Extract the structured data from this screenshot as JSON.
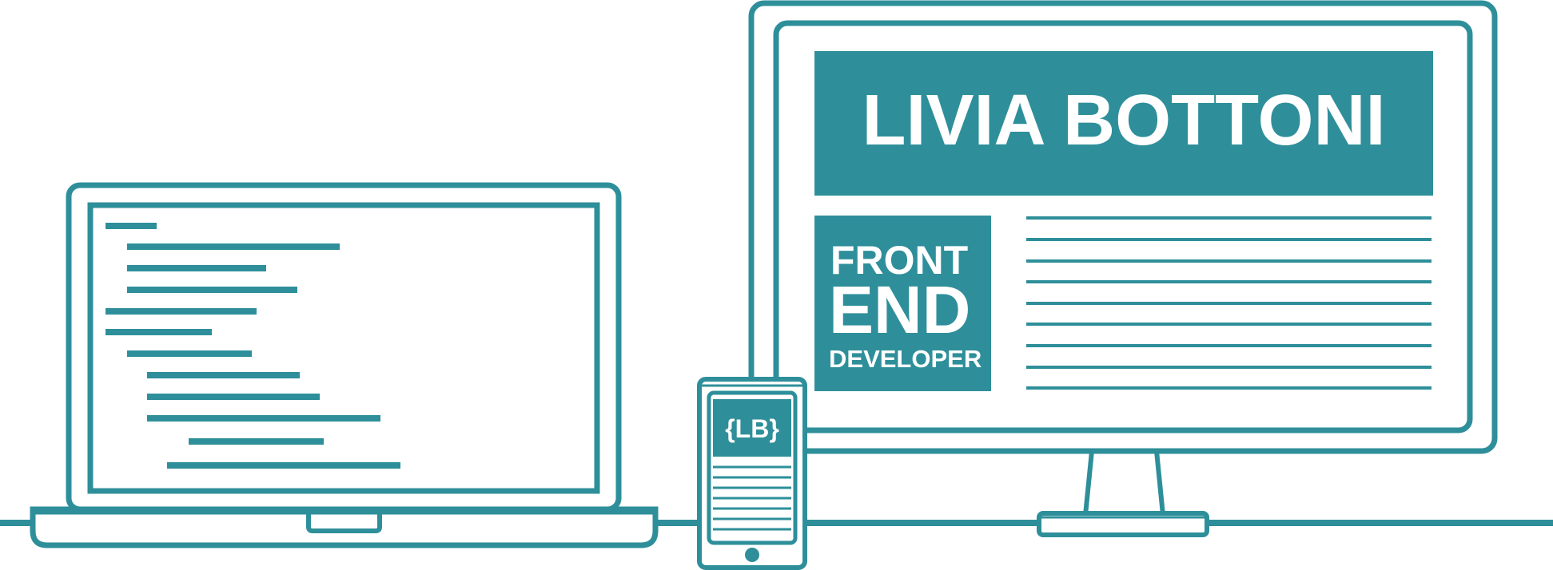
{
  "colors": {
    "teal": "#2e8f9a",
    "background": "#ffffff"
  },
  "monitor": {
    "name_banner": "LIVIA BOTTONI",
    "role_line1": "FRONT",
    "role_line2": "END",
    "role_line3": "DEVELOPER"
  },
  "phone": {
    "logo": "{LB}"
  },
  "icons": {
    "laptop": "laptop-icon",
    "monitor": "monitor-icon",
    "phone": "smartphone-icon"
  }
}
